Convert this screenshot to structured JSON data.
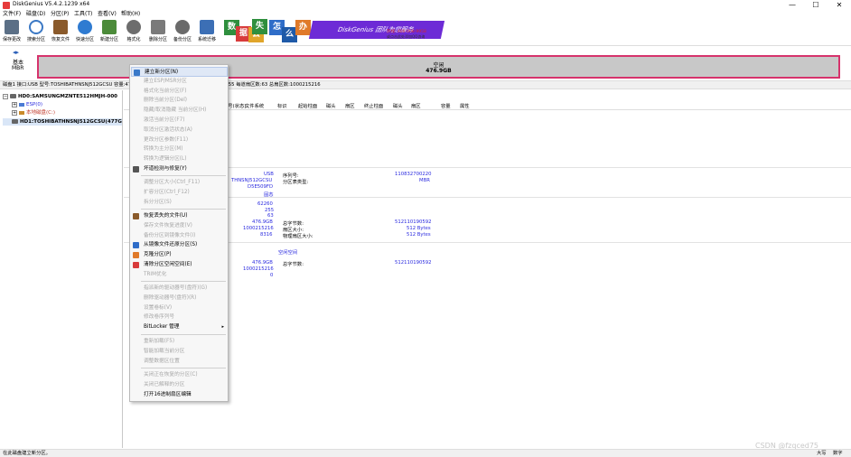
{
  "window": {
    "title": "DiskGenius V5.4.2.1239 x64",
    "minimize": "—",
    "maximize": "☐",
    "close": "✕"
  },
  "menu": [
    "文件(F)",
    "磁盘(D)",
    "分区(P)",
    "工具(T)",
    "查看(V)",
    "帮助(H)"
  ],
  "toolbar": [
    {
      "label": "保存更改",
      "icon": "save-icon",
      "color": "#5b6f86"
    },
    {
      "label": "搜索分区",
      "icon": "search-icon",
      "color": "#3b78c4"
    },
    {
      "label": "恢复文件",
      "icon": "recover-icon",
      "color": "#8a5a2b"
    },
    {
      "label": "快速分区",
      "icon": "quick-partition-icon",
      "color": "#2f7bd1"
    },
    {
      "label": "新建分区",
      "icon": "new-partition-icon",
      "color": "#4c8b3a"
    },
    {
      "label": "格式化",
      "icon": "format-icon",
      "color": "#6d6d6d"
    },
    {
      "label": "删除分区",
      "icon": "delete-icon",
      "color": "#7a7a7a"
    },
    {
      "label": "备份分区",
      "icon": "backup-icon",
      "color": "#6a6a6a"
    },
    {
      "label": "系统迁移",
      "icon": "migrate-icon",
      "color": "#3c6fb5"
    }
  ],
  "banner": {
    "tiles": [
      {
        "text": "数",
        "color": "#2f8f3e"
      },
      {
        "text": "据",
        "color": "#d83b3b"
      },
      {
        "text": "丢",
        "color": "#e0a52a"
      },
      {
        "text": "失",
        "color": "#2f8f3e"
      },
      {
        "text": "怎",
        "color": "#2f6dc8"
      },
      {
        "text": "么",
        "color": "#1f5aa8"
      },
      {
        "text": "办",
        "color": "#e07a2a"
      }
    ],
    "strip": "DiskGenius 团队为您服务",
    "phone": "热线: 400-008-9958",
    "qq": "或点击此处添加QQ咨询"
  },
  "disk_map": {
    "left_label1": "基本",
    "left_label2": "MBR",
    "free_label": "空闲",
    "free_size": "476.9GB"
  },
  "disk_info": "磁盘1 接口:USB  型号:TOSHIBATHNSNJ512GCSU  容量:476.9GB(488386MB)  柱面数:62260  磁头数:255  每道扇区数:63  总扇区数:1000215216",
  "tree": {
    "disk0": "HD0:SAMSUNGMZNTE512HMJH-000",
    "esp": "ESP(0)",
    "local": "本地磁盘(C:)",
    "disk1": "HD1:TOSHIBATHNSNJ512GCSU(477G"
  },
  "partition_header": [
    "卷标",
    "序号(状态)",
    "文件系统",
    "标识",
    "起始柱面",
    "磁头",
    "扇区",
    "终止柱面",
    "磁头",
    "扇区",
    "容量",
    "属性"
  ],
  "details": {
    "iface": "USB",
    "model": "THNSNJ512GCSU",
    "sn": "D5E509FD",
    "mode": "固态",
    "serial_label": "序列号:",
    "serial_value": "110832700220",
    "ptype_label": "分区表类型:",
    "ptype_value": "MBR",
    "cyl": "62260",
    "heads": "255",
    "spt": "63",
    "cap": "476.9GB",
    "sectors": "1000215216",
    "extra": "8316",
    "bytes_label": "总字节数:",
    "bytes_value": "512110190592",
    "sector_size_label": "扇区大小:",
    "sector_size_value": "512 Bytes",
    "phys_label": "物理扇区大小:",
    "phys_value": "512 Bytes",
    "free_space": "空闲空间",
    "cap2": "476.9GB",
    "sectors2": "1000215216",
    "zero": "0",
    "bytes_label2": "总字节数:",
    "bytes_value2": "512110190592"
  },
  "context_menu": [
    {
      "label": "建立新分区(N)",
      "disabled": false,
      "icon": "#3a79c9",
      "hl": true
    },
    {
      "label": "建立ESP/MSR分区",
      "disabled": true
    },
    {
      "label": "格式化当前分区(F)",
      "disabled": true
    },
    {
      "label": "删除当前分区(Del)",
      "disabled": true
    },
    {
      "label": "隐藏/取消隐藏 当前分区(H)",
      "disabled": true
    },
    {
      "label": "激活当前分区(F7)",
      "disabled": true
    },
    {
      "label": "取消分区激活状态(A)",
      "disabled": true
    },
    {
      "label": "更改分区参数(F11)",
      "disabled": true
    },
    {
      "label": "转换为主分区(M)",
      "disabled": true
    },
    {
      "label": "转换为逻辑分区(L)",
      "disabled": true
    },
    {
      "label": "坏道检测与修复(Y)",
      "disabled": false,
      "icon": "#555555"
    },
    {
      "sep": true
    },
    {
      "label": "调整分区大小(Ctrl_F11)",
      "disabled": true
    },
    {
      "label": "扩容分区(Ctrl_F12)",
      "disabled": true
    },
    {
      "label": "拆分分区(S)",
      "disabled": true
    },
    {
      "sep": true
    },
    {
      "label": "恢复丢失的文件(U)",
      "disabled": false,
      "icon": "#8a5a2b"
    },
    {
      "label": "保存文件恢复进度(V)",
      "disabled": true
    },
    {
      "label": "备份分区到镜像文件(I)",
      "disabled": true
    },
    {
      "label": "从镜像文件还原分区(S)",
      "disabled": false,
      "icon": "#2f6dc8"
    },
    {
      "label": "克隆分区(P)",
      "disabled": false,
      "icon": "#e07a2a"
    },
    {
      "label": "清除分区空闲空间(E)",
      "disabled": false,
      "icon": "#d83b3b"
    },
    {
      "label": "TRIM优化",
      "disabled": true
    },
    {
      "sep": true
    },
    {
      "label": "指派新的驱动器号(盘符)(G)",
      "disabled": true
    },
    {
      "label": "删除驱动器号(盘符)(R)",
      "disabled": true
    },
    {
      "label": "设置卷标(V)",
      "disabled": true
    },
    {
      "label": "修改卷序列号",
      "disabled": true
    },
    {
      "label": "BitLocker 管理",
      "disabled": false,
      "submenu": true
    },
    {
      "sep": true
    },
    {
      "label": "重新加载(F5)",
      "disabled": true
    },
    {
      "label": "智能加载当前分区",
      "disabled": true
    },
    {
      "label": "调整数据区位置",
      "disabled": true
    },
    {
      "sep": true
    },
    {
      "label": "关闭正在恢复的分区(C)",
      "disabled": true
    },
    {
      "label": "关闭已解释的分区",
      "disabled": true
    },
    {
      "label": "打开16进制扇区编辑",
      "disabled": false
    }
  ],
  "status": {
    "left": "在此磁盘建立新分区。",
    "right1": "大写",
    "right2": "数字"
  },
  "watermark": "CSDN @fzqced75"
}
